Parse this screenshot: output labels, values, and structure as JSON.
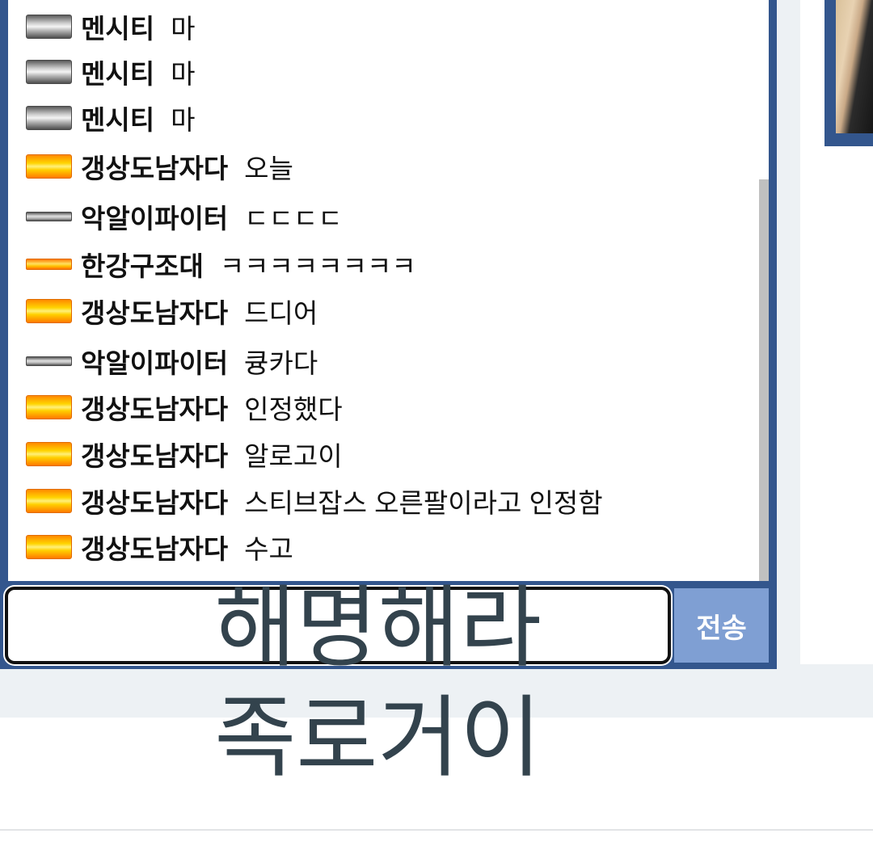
{
  "chat": {
    "messages": [
      {
        "badge": "silver",
        "nick": "멘시티",
        "text": "마"
      },
      {
        "badge": "silver",
        "nick": "멘시티",
        "text": "마"
      },
      {
        "badge": "silver",
        "nick": "멘시티",
        "text": "마"
      },
      {
        "badge": "gold",
        "nick": "갱상도남자다",
        "text": "오늘"
      },
      {
        "badge": "silver-thin",
        "nick": "악알이파이터",
        "text": "ㄷㄷㄷㄷ"
      },
      {
        "badge": "gold-thin",
        "nick": "한강구조대",
        "text": "ㅋㅋㅋㅋㅋㅋㅋㅋ"
      },
      {
        "badge": "gold",
        "nick": "갱상도남자다",
        "text": "드디어"
      },
      {
        "badge": "silver-thin",
        "nick": "악알이파이터",
        "text": "큥카다"
      },
      {
        "badge": "gold",
        "nick": "갱상도남자다",
        "text": "인정했다"
      },
      {
        "badge": "gold",
        "nick": "갱상도남자다",
        "text": "알로고이"
      },
      {
        "badge": "gold",
        "nick": "갱상도남자다",
        "text": "스티브잡스 오른팔이라고 인정함"
      },
      {
        "badge": "gold",
        "nick": "갱상도남자다",
        "text": "수고"
      }
    ],
    "input_value": "",
    "send_label": "전송"
  },
  "caption": {
    "line1": "해명해라",
    "line2": "족로거이"
  },
  "colors": {
    "panel_border": "#33568d",
    "send_button": "#7f9fd3",
    "scrollbar": "#c0c0c0",
    "caption_text": "#33434d"
  }
}
